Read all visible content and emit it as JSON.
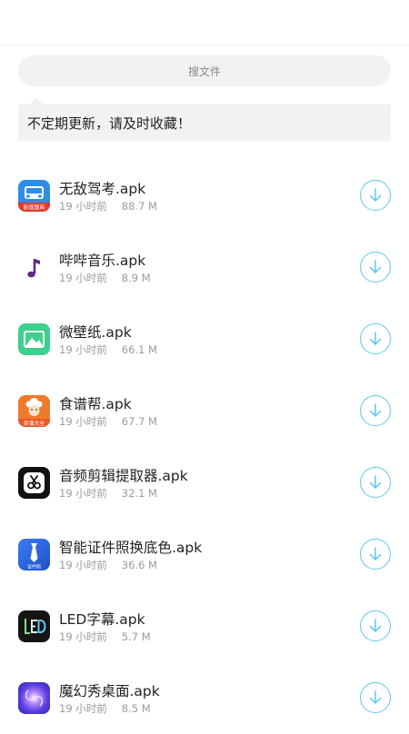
{
  "search": {
    "placeholder": "搜文件"
  },
  "notice": {
    "text": "不定期更新，请及时收藏！"
  },
  "accent_color": "#5cc8f0",
  "files": [
    {
      "name": "无敌驾考.apk",
      "time": "19 小时前",
      "size": "88.7 M",
      "icon": "car-icon",
      "icon_label": "新规题库"
    },
    {
      "name": "哔哔音乐.apk",
      "time": "19 小时前",
      "size": "8.9 M",
      "icon": "music-note-icon"
    },
    {
      "name": "微壁纸.apk",
      "time": "19 小时前",
      "size": "66.1 M",
      "icon": "mountain-picture-icon"
    },
    {
      "name": "食谱帮.apk",
      "time": "19 小时前",
      "size": "67.7 M",
      "icon": "chef-icon",
      "icon_label": "菜谱大全"
    },
    {
      "name": "音频剪辑提取器.apk",
      "time": "19 小时前",
      "size": "32.1 M",
      "icon": "scissors-icon"
    },
    {
      "name": "智能证件照换底色.apk",
      "time": "19 小时前",
      "size": "36.6 M",
      "icon": "tie-icon",
      "icon_label": "证件照"
    },
    {
      "name": "LED字幕.apk",
      "time": "19 小时前",
      "size": "5.7 M",
      "icon": "led-icon"
    },
    {
      "name": "魔幻秀桌面.apk",
      "time": "19 小时前",
      "size": "8.5 M",
      "icon": "galaxy-icon"
    }
  ]
}
